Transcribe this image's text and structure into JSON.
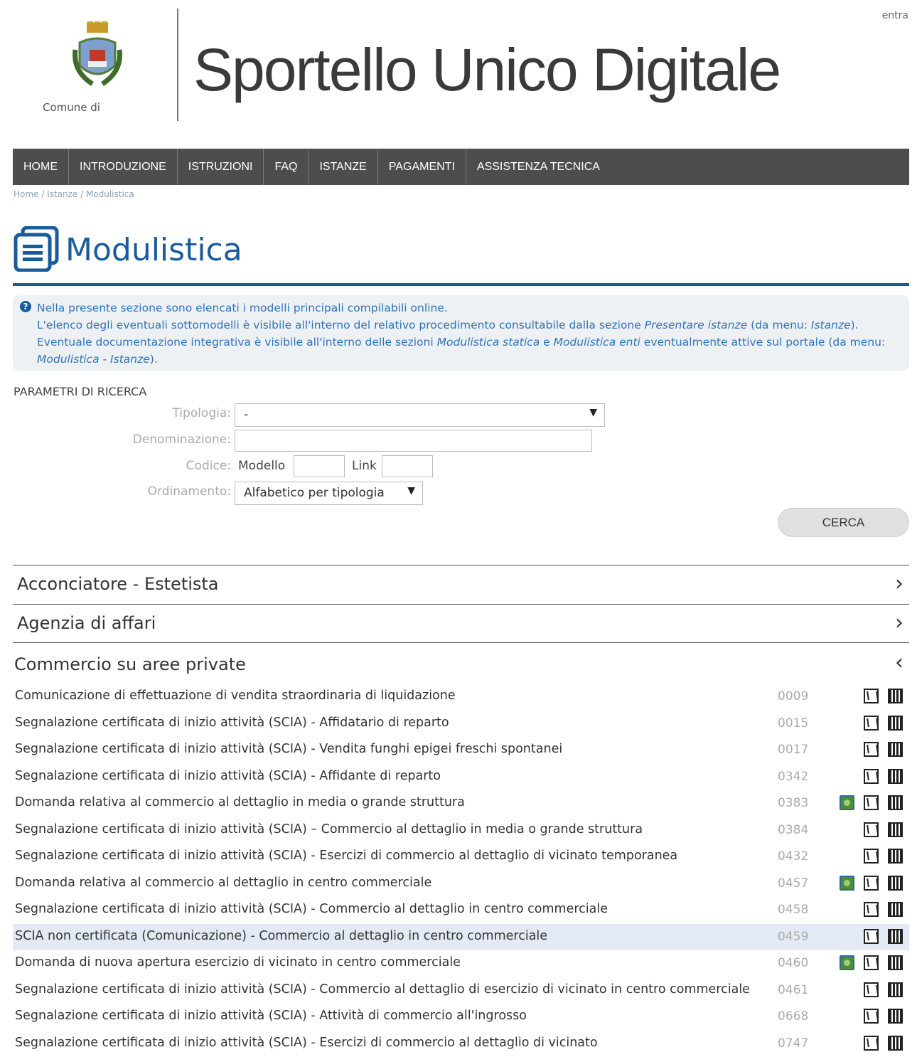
{
  "header": {
    "login_link": "entra",
    "comune_label": "Comune di",
    "site_title": "Sportello Unico Digitale"
  },
  "nav": [
    {
      "label": "HOME"
    },
    {
      "label": "INTRODUZIONE"
    },
    {
      "label": "ISTRUZIONI"
    },
    {
      "label": "FAQ"
    },
    {
      "label": "ISTANZE"
    },
    {
      "label": "PAGAMENTI"
    },
    {
      "label": "ASSISTENZA TECNICA"
    }
  ],
  "breadcrumb": {
    "home": "Home",
    "sep": " / ",
    "istanze": "Istanze",
    "current": "Modulistica"
  },
  "page_title": "Modulistica",
  "info": {
    "line1": "Nella presente sezione sono elencati i modelli principali compilabili online.",
    "line2a": "L'elenco degli eventuali sottomodelli è visibile all'interno del relativo procedimento consultabile dalla sezione ",
    "line2b": "Presentare istanze",
    "line2c": " (da menu: ",
    "line2d": "Istanze",
    "line2e": ").",
    "line3a": "Eventuale documentazione integrativa è visibile all'interno delle sezioni ",
    "line3b": "Modulistica statica",
    "line3c": " e ",
    "line3d": "Modulistica enti",
    "line3e": " eventualmente attive sul portale (da menu: ",
    "line3f": "Modulistica - Istanze",
    "line3g": ")."
  },
  "search": {
    "title": "PARAMETRI DI RICERCA",
    "tipologia_label": "Tipologia:",
    "tipologia_value": "-",
    "denominazione_label": "Denominazione:",
    "denominazione_value": "",
    "codice_label": "Codice:",
    "modello_label": "Modello",
    "modello_value": "",
    "link_label": "Link",
    "link_value": "",
    "ordinamento_label": "Ordinamento:",
    "ordinamento_value": "Alfabetico per tipologia",
    "submit_label": "CERCA"
  },
  "categories": [
    {
      "label": "Acconciatore - Estetista",
      "expanded": false,
      "chevron": "›"
    },
    {
      "label": "Agenzia di affari",
      "expanded": false,
      "chevron": "›"
    },
    {
      "label": "Commercio su aree private",
      "expanded": true,
      "chevron": "‹"
    }
  ],
  "forms": [
    {
      "title": "Comunicazione di effettuazione di vendita straordinaria di liquidazione",
      "code": "0009",
      "online": false
    },
    {
      "title": "Segnalazione certificata di inizio attività (SCIA) - Affidatario di reparto",
      "code": "0015",
      "online": false
    },
    {
      "title": "Segnalazione certificata di inizio attività (SCIA) - Vendita funghi epigei freschi spontanei",
      "code": "0017",
      "online": false
    },
    {
      "title": "Segnalazione certificata di inizio attività (SCIA) - Affidante di reparto",
      "code": "0342",
      "online": false
    },
    {
      "title": "Domanda relativa al commercio al dettaglio in media o grande struttura",
      "code": "0383",
      "online": true
    },
    {
      "title": "Segnalazione certificata di inizio attività (SCIA) – Commercio al dettaglio in media o grande struttura",
      "code": "0384",
      "online": false
    },
    {
      "title": "Segnalazione certificata di inizio attività (SCIA) - Esercizi di commercio al dettaglio di vicinato temporanea",
      "code": "0432",
      "online": false
    },
    {
      "title": "Domanda relativa al commercio al dettaglio in centro commerciale",
      "code": "0457",
      "online": true
    },
    {
      "title": "Segnalazione certificata di inizio attività (SCIA) - Commercio al dettaglio in centro commerciale",
      "code": "0458",
      "online": false
    },
    {
      "title": "SCIA non certificata (Comunicazione) - Commercio al dettaglio in centro commerciale",
      "code": "0459",
      "online": false,
      "highlighted": true
    },
    {
      "title": "Domanda di nuova apertura esercizio di vicinato in centro commerciale",
      "code": "0460",
      "online": true
    },
    {
      "title": "Segnalazione certificata di inizio attività (SCIA) - Commercio al dettaglio di esercizio di vicinato in centro commerciale",
      "code": "0461",
      "online": false
    },
    {
      "title": "Segnalazione certificata di inizio attività (SCIA) - Attività di commercio all'ingrosso",
      "code": "0668",
      "online": false
    },
    {
      "title": "Segnalazione certificata di inizio attività (SCIA) - Esercizi di commercio al dettaglio di vicinato",
      "code": "0747",
      "online": false
    }
  ],
  "colors": {
    "accent": "#1a5b9c",
    "nav_bg": "#4d4d4d",
    "info_text": "#2f73b8",
    "row_highlight": "#e3eaf5"
  }
}
